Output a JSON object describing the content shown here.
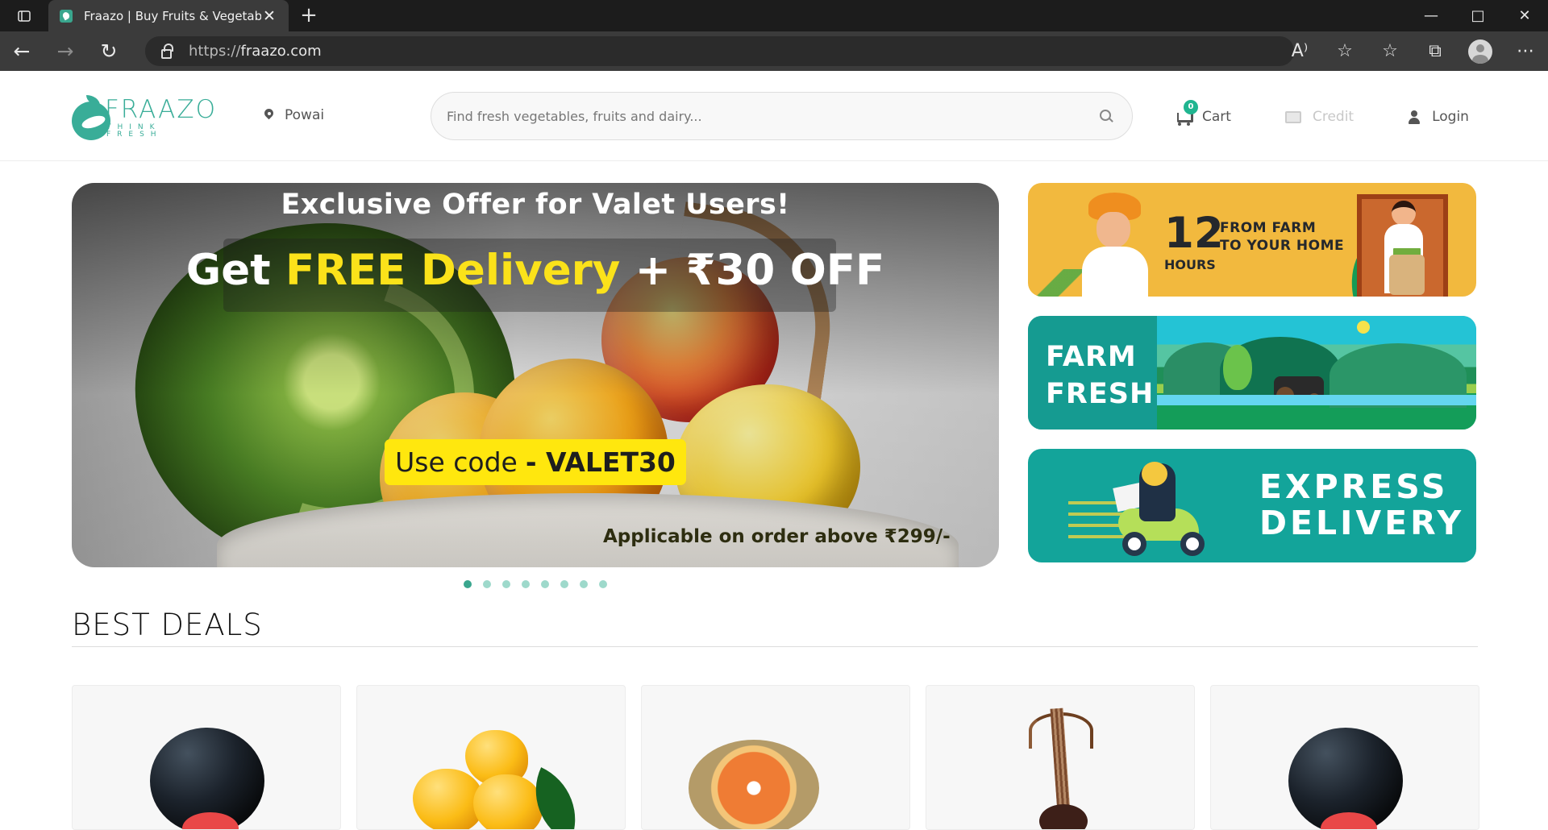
{
  "browser": {
    "tab_title": "Fraazo | Buy Fruits & Vegetables",
    "tab_close_symbol": "✕",
    "new_tab_symbol": "+",
    "minimize_symbol": "—",
    "maximize_symbol": "□",
    "close_symbol": "✕",
    "url_scheme": "https://",
    "url_host": "fraazo.com",
    "back_symbol": "←",
    "forward_symbol": "→",
    "refresh_symbol": "↻",
    "read_aloud_symbol": "A⁾",
    "favorite_add_symbol": "☆",
    "favorites_symbol": "☆",
    "collections_symbol": "⧉",
    "more_symbol": "⋯"
  },
  "header": {
    "logo_text": "FRAAZO",
    "logo_tagline": "THINK FRESH",
    "location": "Powai",
    "search_placeholder": "Find fresh vegetables, fruits and dairy...",
    "cart_count": "0",
    "cart_label": "Cart",
    "credit_label": "Credit",
    "login_label": "Login"
  },
  "hero": {
    "title": "Exclusive Offer for Valet Users!",
    "offer_prefix": "Get ",
    "offer_highlight": "FREE Delivery",
    "offer_suffix": " + ₹30 OFF",
    "code_prefix": "Use code ",
    "code": "- VALET30",
    "terms": "Applicable on order above ₹299/-",
    "dots": 8,
    "active_dot": 1
  },
  "promos": {
    "farm_number": "12",
    "farm_line1": "FROM FARM",
    "farm_line2": "TO YOUR HOME",
    "farm_hours": "HOURS",
    "fresh_line1": "FARM",
    "fresh_line2": "FRESH",
    "express_line1": "EXPRESS",
    "express_line2": "DELIVERY"
  },
  "section": {
    "best_deals": "BEST DEALS"
  },
  "colors": {
    "brand": "#3aa68e",
    "promo_yellow": "#f2b93e",
    "promo_teal": "#16a39a",
    "offer_yellow": "#fbe21a"
  }
}
